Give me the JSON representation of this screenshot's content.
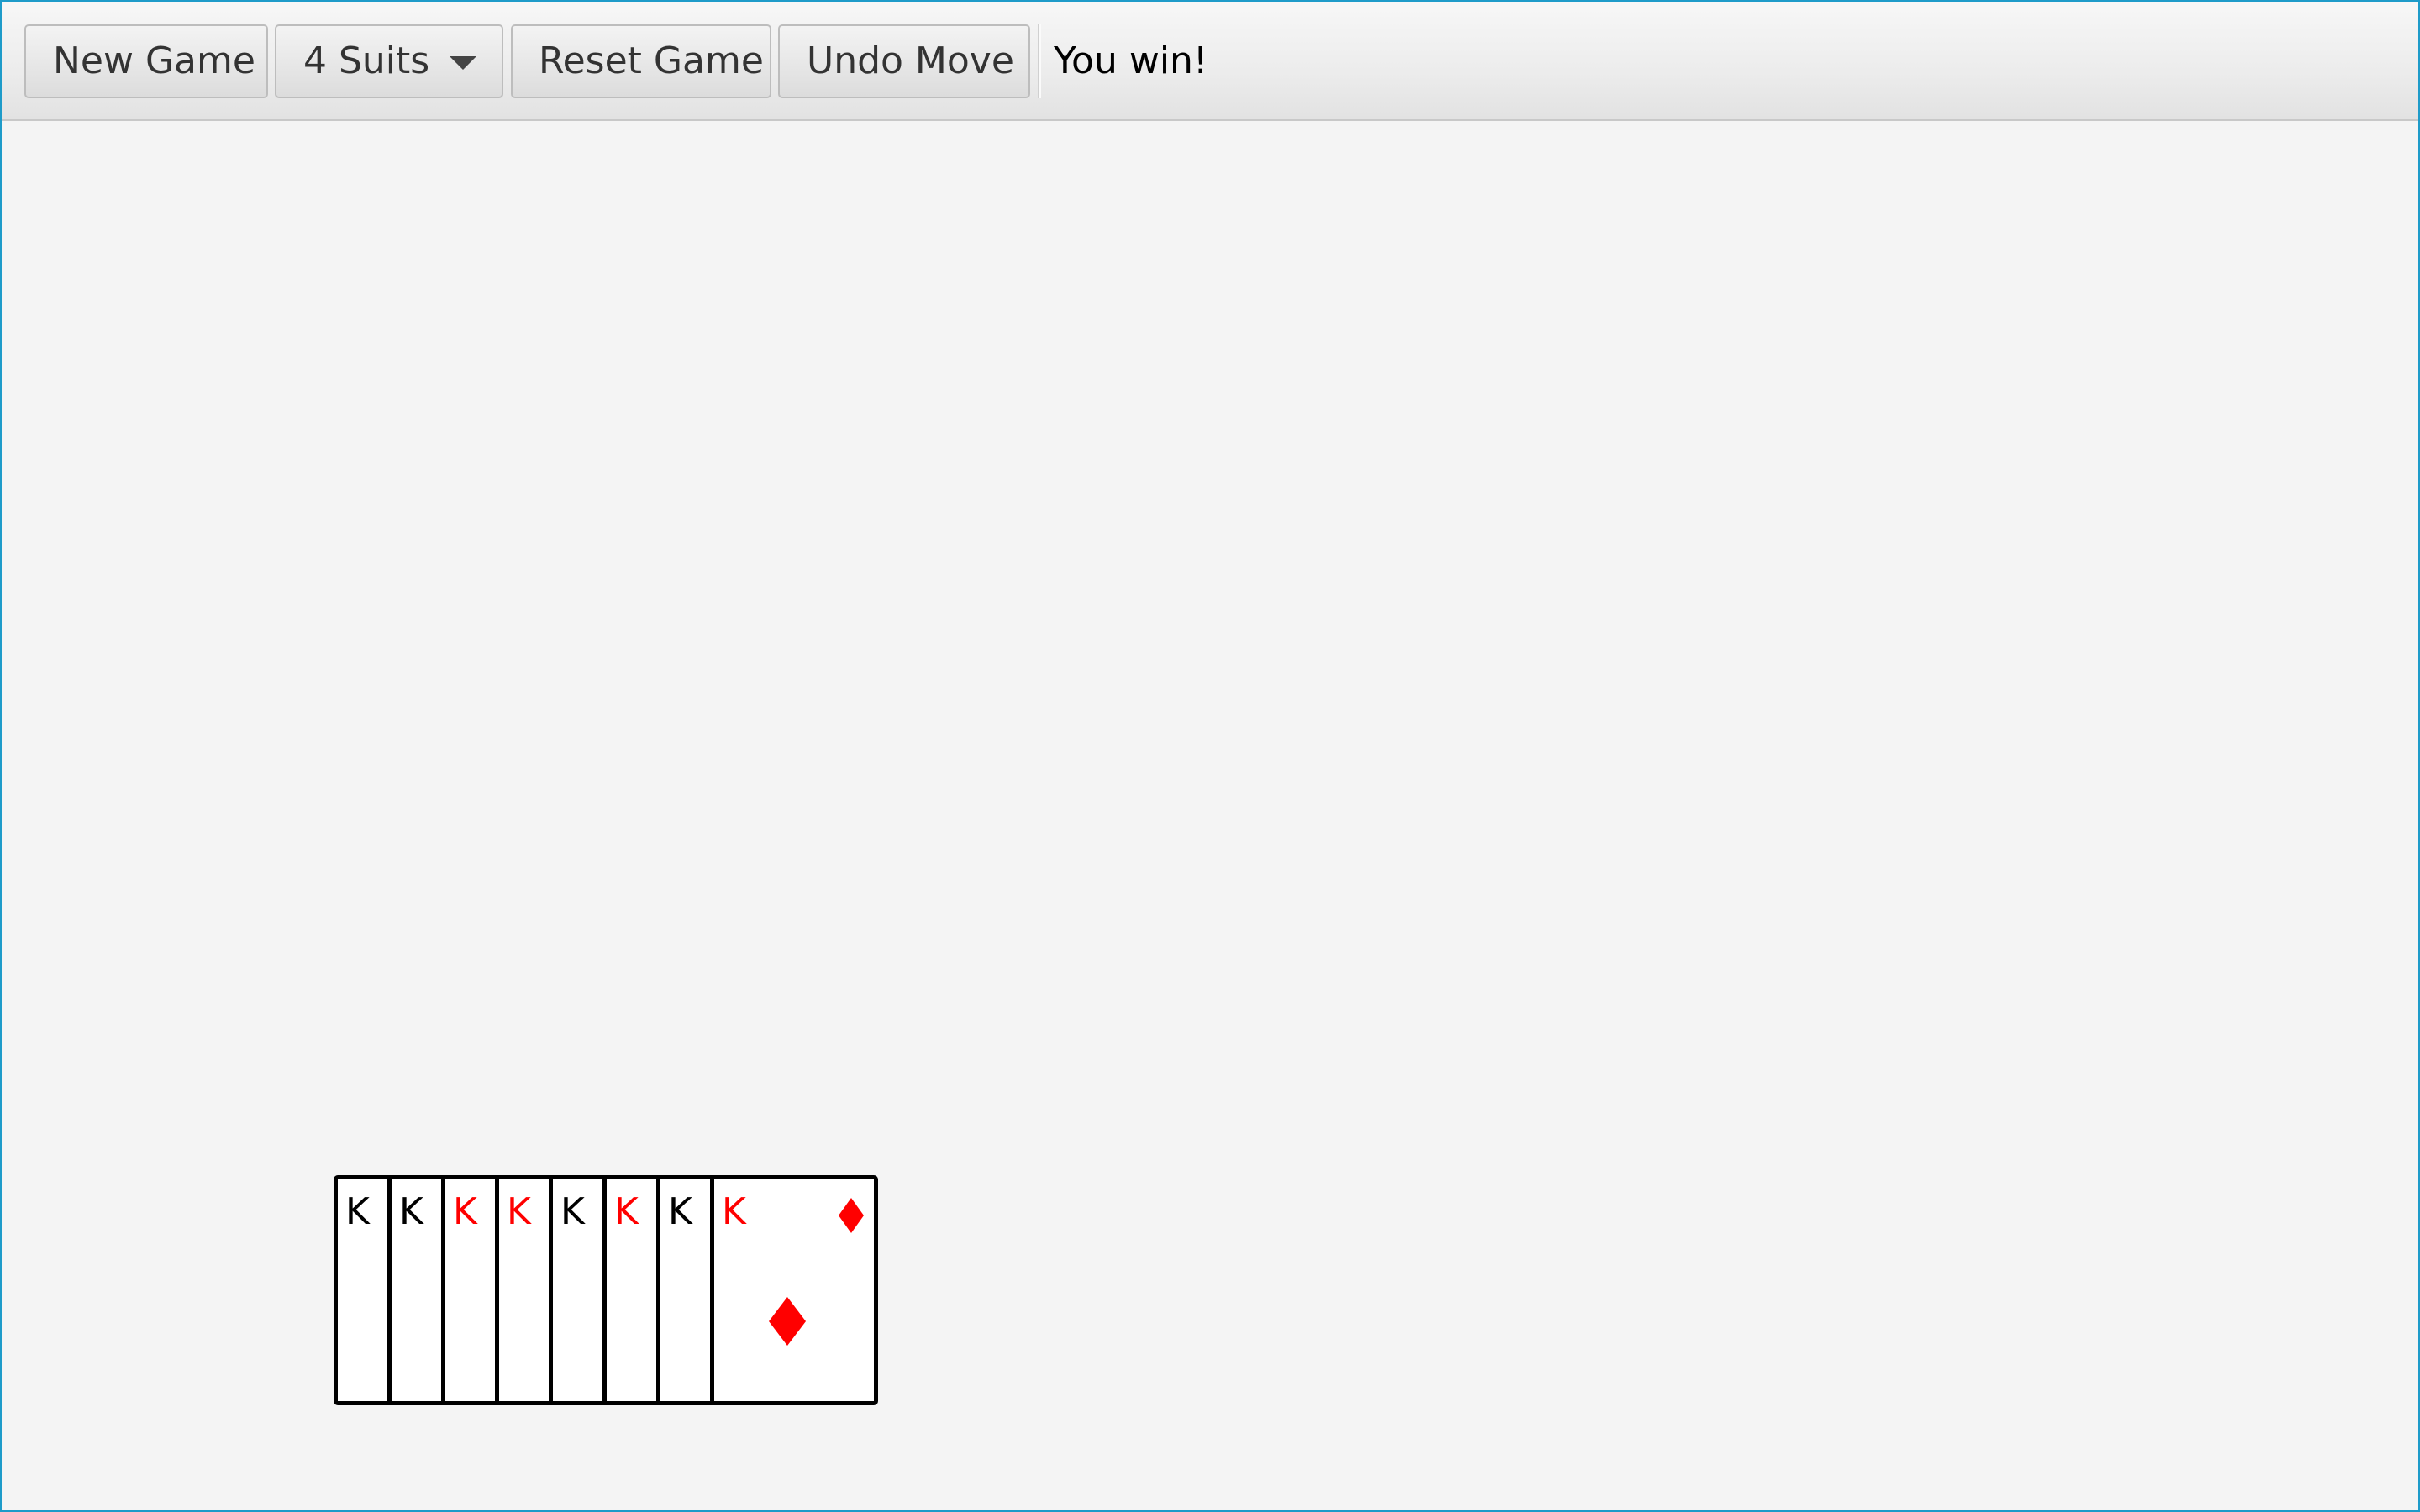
{
  "toolbar": {
    "new_game_label": "New Game",
    "suits_selected": "4 Suits",
    "reset_game_label": "Reset Game",
    "undo_move_label": "Undo Move",
    "status_text": "You win!"
  },
  "colors": {
    "red_suit": "#ff0000",
    "black_suit": "#000000",
    "window_border": "#1e9bc9",
    "board_background": "#f4f4f4"
  },
  "foundation": {
    "cards": [
      {
        "rank": "K",
        "color": "black"
      },
      {
        "rank": "K",
        "color": "black"
      },
      {
        "rank": "K",
        "color": "red"
      },
      {
        "rank": "K",
        "color": "red"
      },
      {
        "rank": "K",
        "color": "black"
      },
      {
        "rank": "K",
        "color": "red"
      },
      {
        "rank": "K",
        "color": "black"
      },
      {
        "rank": "K",
        "color": "red",
        "suit": "diamond-icon"
      }
    ]
  }
}
